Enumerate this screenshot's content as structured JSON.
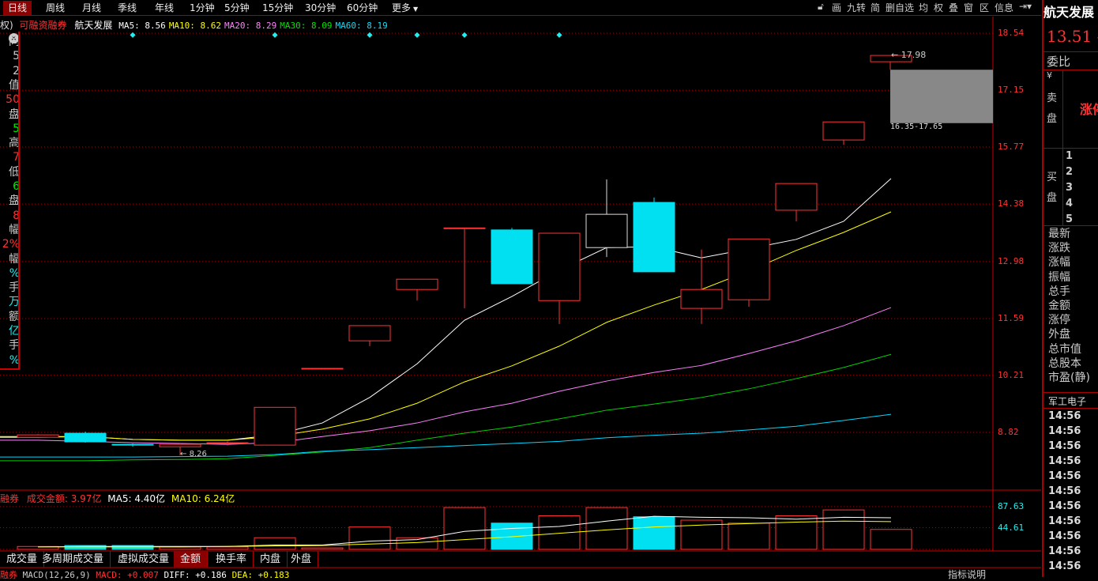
{
  "toolbar": {
    "timeframes": [
      "日线",
      "周线",
      "月线",
      "季线",
      "年线",
      "1分钟",
      "5分钟",
      "15分钟",
      "30分钟",
      "60分钟",
      "更多"
    ],
    "active": 0,
    "tools": [
      "画",
      "九转",
      "简",
      "删自选",
      "均",
      "权",
      "叠",
      "窗",
      "区",
      "信息"
    ]
  },
  "header": {
    "prefix": "权)",
    "tag": "可融资融券",
    "name": "航天发展",
    "ma": [
      {
        "label": "MA5: 8.56",
        "color": "#ffffff"
      },
      {
        "label": "MA10: 8.62",
        "color": "#ffff00"
      },
      {
        "label": "MA20: 8.29",
        "color": "#ff80ff"
      },
      {
        "label": "MA30: 8.09",
        "color": "#00e000"
      },
      {
        "label": "MA60: 8.19",
        "color": "#00e0ff"
      }
    ]
  },
  "price_axis": [
    "18.54",
    "17.15",
    "15.77",
    "14.38",
    "12.98",
    "11.59",
    "10.21",
    "8.82"
  ],
  "chart_data": {
    "type": "candlestick",
    "ylim": [
      8.82,
      18.54
    ],
    "candles": [
      {
        "o": 8.7,
        "c": 8.76,
        "h": 8.78,
        "l": 8.68
      },
      {
        "o": 8.8,
        "c": 8.59,
        "h": 8.84,
        "l": 8.57
      },
      {
        "o": 8.53,
        "c": 8.51,
        "h": 8.55,
        "l": 8.47
      },
      {
        "o": 8.47,
        "c": 8.53,
        "h": 8.55,
        "l": 8.26
      },
      {
        "o": 8.55,
        "c": 8.57,
        "h": 8.6,
        "l": 8.5
      },
      {
        "o": 8.51,
        "c": 9.43,
        "h": 9.43,
        "l": 8.51
      },
      {
        "o": 10.37,
        "c": 10.38,
        "h": 10.38,
        "l": 10.37
      },
      {
        "o": 11.05,
        "c": 11.42,
        "h": 11.42,
        "l": 10.92
      },
      {
        "o": 12.3,
        "c": 12.55,
        "h": 12.55,
        "l": 12.03
      },
      {
        "o": 13.78,
        "c": 13.8,
        "h": 13.8,
        "l": 11.84
      },
      {
        "o": 13.75,
        "c": 12.44,
        "h": 13.8,
        "l": 12.44
      },
      {
        "o": 12.03,
        "c": 13.67,
        "h": 13.67,
        "l": 11.46
      },
      {
        "o": 13.32,
        "c": 14.13,
        "h": 14.98,
        "l": 13.09,
        "neutral": true
      },
      {
        "o": 14.42,
        "c": 12.73,
        "h": 14.54,
        "l": 12.73
      },
      {
        "o": 11.84,
        "c": 12.3,
        "h": 13.27,
        "l": 11.46
      },
      {
        "o": 12.05,
        "c": 13.53,
        "h": 13.53,
        "l": 11.88
      },
      {
        "o": 14.23,
        "c": 14.88,
        "h": 14.88,
        "l": 13.96
      },
      {
        "o": 15.94,
        "c": 16.38,
        "h": 16.38,
        "l": 15.82
      }
    ],
    "ma": {
      "MA5": [
        8.72,
        8.72,
        8.65,
        8.63,
        8.63,
        8.76,
        9.05,
        9.67,
        10.49,
        11.55,
        12.13,
        12.77,
        13.32,
        13.34,
        13.07,
        13.29,
        13.52,
        13.96,
        15.0
      ],
      "MA10": [
        8.7,
        8.72,
        8.65,
        8.63,
        8.63,
        8.72,
        8.9,
        9.15,
        9.53,
        10.05,
        10.44,
        10.92,
        11.5,
        11.92,
        12.3,
        12.75,
        13.25,
        13.69,
        14.19
      ],
      "MA20": [
        8.63,
        8.6,
        8.57,
        8.55,
        8.53,
        8.57,
        8.72,
        8.86,
        9.05,
        9.32,
        9.53,
        9.82,
        10.07,
        10.28,
        10.45,
        10.74,
        11.05,
        11.42,
        11.86
      ],
      "MA30": [
        8.13,
        8.13,
        8.15,
        8.16,
        8.18,
        8.26,
        8.34,
        8.45,
        8.63,
        8.8,
        8.95,
        9.15,
        9.36,
        9.51,
        9.67,
        9.88,
        10.13,
        10.4,
        10.72
      ],
      "MA60": [
        8.22,
        8.22,
        8.22,
        8.23,
        8.24,
        8.28,
        8.36,
        8.4,
        8.45,
        8.5,
        8.55,
        8.6,
        8.69,
        8.75,
        8.8,
        8.88,
        8.97,
        9.11,
        9.26
      ]
    },
    "ma_colors": {
      "MA5": "#ffffff",
      "MA10": "#ffff00",
      "MA20": "#ff80ff",
      "MA30": "#00d000",
      "MA60": "#00d8ff"
    },
    "signal_markers": [
      2,
      5,
      7,
      8,
      9,
      11
    ],
    "forecast": {
      "low": 16.35,
      "high": 17.65,
      "label": "16.35-17.65"
    },
    "high_marker": {
      "value": 17.98,
      "label": "17.98"
    },
    "low_marker": {
      "value": 8.26,
      "label": "8.26"
    },
    "volume": {
      "values": [
        6,
        8,
        8,
        5,
        5,
        24,
        3,
        46,
        24,
        86,
        54,
        69,
        86,
        67,
        60,
        54,
        69,
        81,
        41
      ],
      "ma5": [
        5,
        6,
        6,
        6,
        6,
        9,
        9,
        17,
        20,
        37,
        43,
        47,
        58,
        68,
        66,
        65,
        62,
        66,
        65
      ],
      "ma10": [
        5,
        5,
        5,
        5,
        6,
        7,
        8,
        11,
        14,
        20,
        26,
        33,
        40,
        46,
        50,
        53,
        56,
        58,
        57
      ],
      "axis": [
        "87.63",
        "44.61"
      ],
      "ymax": 87.63
    }
  },
  "volume_header": {
    "prefix": "融券",
    "label": "成交金额:",
    "value": "3.97亿",
    "ma5": "MA5: 4.40亿",
    "ma10": "MA10: 6.24亿"
  },
  "tabs": [
    "成交量",
    "多周期成交量",
    "虚拟成交量",
    "金额",
    "换手率",
    "内盘",
    "外盘"
  ],
  "active_tab": 3,
  "macd": {
    "prefix": "融券",
    "name": "MACD(12,26,9)",
    "macd": "MACD: +0.007",
    "diff": "DIFF: +0.186",
    "dea": "DEA: +0.183",
    "help": "指标说明"
  },
  "right": {
    "name": "航天发展",
    "price": "13.51 -",
    "weibi": "委比",
    "sell": "卖盘",
    "sell_top": "¥",
    "limit": "涨停",
    "buy": "买盘",
    "levels": [
      "1",
      "2",
      "3",
      "4",
      "5"
    ],
    "fields": [
      "最新",
      "涨跌",
      "涨幅",
      "振幅",
      "总手",
      "金额",
      "涨停",
      "外盘",
      "总市值",
      "总股本",
      "市盈(静)"
    ],
    "sector": "军工电子",
    "ticks": [
      "14:56",
      "14:56",
      "14:56",
      "14:56",
      "14:56",
      "14:56",
      "14:56",
      "14:56",
      "14:56",
      "14:56",
      "14:56"
    ]
  },
  "left": [
    {
      "t": "同",
      "c": "#ccc"
    },
    {
      "t": "5",
      "c": "#ccc"
    },
    {
      "t": "2",
      "c": "#ccc"
    },
    {
      "t": "值",
      "c": "#ccc"
    },
    {
      "t": "50",
      "c": "#f33"
    },
    {
      "t": "盘",
      "c": "#ccc"
    },
    {
      "t": "5",
      "c": "#0e0"
    },
    {
      "t": "高",
      "c": "#ccc"
    },
    {
      "t": "7",
      "c": "#f33"
    },
    {
      "t": "低",
      "c": "#ccc"
    },
    {
      "t": "6",
      "c": "#0e0"
    },
    {
      "t": "盘",
      "c": "#ccc"
    },
    {
      "t": "8",
      "c": "#f33"
    },
    {
      "t": "幅",
      "c": "#ccc"
    },
    {
      "t": "2%",
      "c": "#f33"
    },
    {
      "t": "幅",
      "c": "#ccc"
    },
    {
      "t": "%",
      "c": "#2ee"
    },
    {
      "t": "手",
      "c": "#ccc"
    },
    {
      "t": "万",
      "c": "#2ee"
    },
    {
      "t": "额",
      "c": "#ccc"
    },
    {
      "t": "亿",
      "c": "#2ee"
    },
    {
      "t": "手",
      "c": "#ccc"
    },
    {
      "t": "%",
      "c": "#2ee"
    }
  ]
}
